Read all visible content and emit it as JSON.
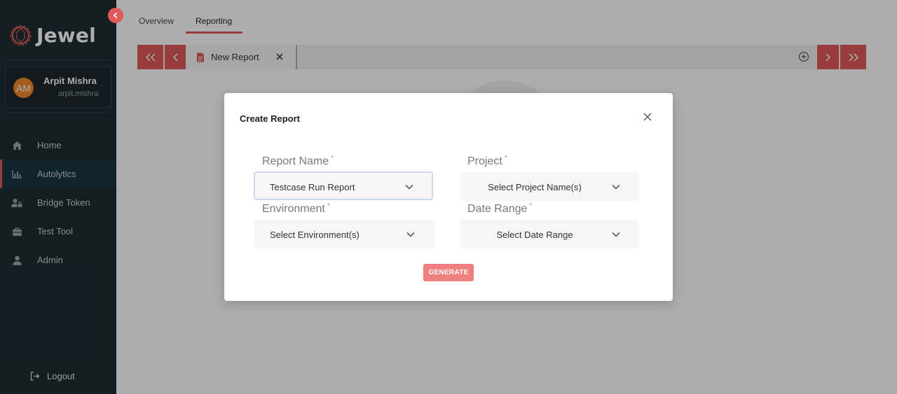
{
  "app": {
    "brand_name": "Jewel"
  },
  "user": {
    "initials": "AM",
    "name": "Arpit Mishra",
    "handle": "arpit.mishra"
  },
  "sidebar": {
    "items": [
      {
        "label": "Home",
        "icon": "home-icon",
        "active": false
      },
      {
        "label": "Autolytics",
        "icon": "bar-chart-icon",
        "active": true
      },
      {
        "label": "Bridge Token",
        "icon": "user-lock-icon",
        "active": false
      },
      {
        "label": "Test Tool",
        "icon": "toolbox-icon",
        "active": false
      },
      {
        "label": "Admin",
        "icon": "user-icon",
        "active": false
      }
    ],
    "logout_label": "Logout"
  },
  "top_tabs": [
    {
      "label": "Overview",
      "active": false
    },
    {
      "label": "Reporting",
      "active": true
    }
  ],
  "report_tabs": [
    {
      "label": "New Report",
      "icon": "document-icon"
    }
  ],
  "modal": {
    "title": "Create Report",
    "fields": {
      "report_name": {
        "label": "Report Name",
        "required_mark": "*",
        "value": "Testcase Run Report"
      },
      "project": {
        "label": "Project",
        "required_mark": "*",
        "placeholder": "Select Project Name(s)"
      },
      "environment": {
        "label": "Environment",
        "required_mark": "*",
        "placeholder": "Select Environment(s)"
      },
      "date_range": {
        "label": "Date Range",
        "required_mark": "*",
        "placeholder": "Select Date Range"
      }
    },
    "generate_label": "GENERATE"
  },
  "colors": {
    "accent": "#e05a5a",
    "sidebar_bg": "#1e2b33",
    "generate_bg": "#f07f7f",
    "avatar_bg": "#f08a2b"
  }
}
